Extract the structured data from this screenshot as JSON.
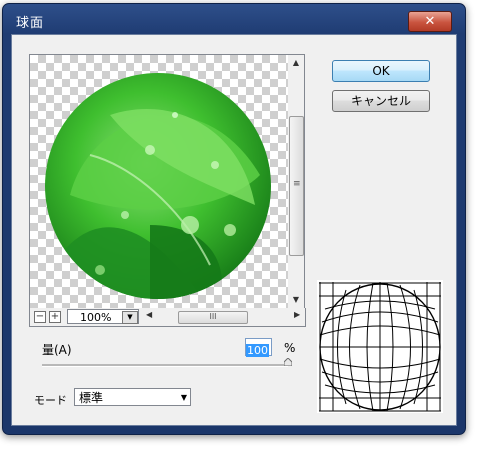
{
  "window": {
    "title": "球面",
    "close_glyph": "✕"
  },
  "buttons": {
    "ok": "OK",
    "cancel": "キャンセル"
  },
  "preview": {
    "zoom_out": "−",
    "zoom_in": "+",
    "zoom_value": "100%",
    "scroll_grip_v": "≡",
    "scroll_grip_h": "III"
  },
  "amount": {
    "label": "量(A)",
    "value": "100",
    "unit": "%",
    "level_percent": 100
  },
  "mode": {
    "label": "モード",
    "value": "標準"
  },
  "colors": {
    "title_bar": "#1f3c73",
    "accent": "#3399ff",
    "leaf_green": "#2fb52b"
  }
}
